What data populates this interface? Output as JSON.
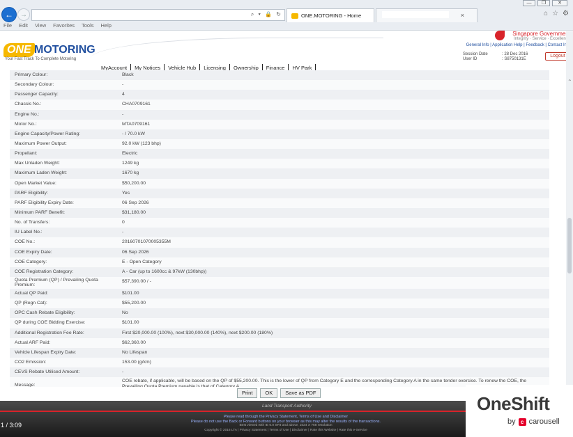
{
  "browser": {
    "tab_title": "ONE.MOTORING - Home",
    "menu": [
      "File",
      "Edit",
      "View",
      "Favorites",
      "Tools",
      "Help"
    ],
    "address_icons": "⌕ ▾ 🔒 ↻",
    "tab_close": "×",
    "window_controls": [
      "—",
      "❐",
      "✕"
    ],
    "toolbar_icons": [
      "⌂",
      "☆",
      "⚙"
    ]
  },
  "header": {
    "logo_one": "ONE",
    "logo_motoring": "MOTORING",
    "logo_tagline": "Your Fast Track To Complete Motoring",
    "gov_name": "Singapore Government",
    "gov_tagline": "Integrity · Service · Excellence",
    "util_links": "General Info | Application Help | Feedback | Contact Info",
    "session_label": "Session Date",
    "session_value": ": 28 Dec 2016",
    "user_label": "User ID",
    "user_value": ": S8750131E",
    "logout": "Logout",
    "nav": [
      "MyAccount",
      "My Notices",
      "Vehicle Hub",
      "Licensing",
      "Ownership",
      "Finance",
      "HV Park"
    ]
  },
  "details": [
    {
      "label": "Primary Colour:",
      "value": "Black"
    },
    {
      "label": "Secondary Colour:",
      "value": "-"
    },
    {
      "label": "Passenger Capacity:",
      "value": "4"
    },
    {
      "label": "Chassis No.:",
      "value": "CHA0709161"
    },
    {
      "label": "Engine No.:",
      "value": "-"
    },
    {
      "label": "Motor No.:",
      "value": "MTA0709161"
    },
    {
      "label": "Engine Capacity/Power Rating:",
      "value": "- / 70.0 kW"
    },
    {
      "label": "Maximum Power Output:",
      "value": "92.0 kW (123 bhp)"
    },
    {
      "label": "Propellant:",
      "value": "Electric"
    },
    {
      "label": "Max Unladen Weight:",
      "value": "1249 kg"
    },
    {
      "label": "Maximum Laden Weight:",
      "value": "1670 kg"
    },
    {
      "label": "Open Market Value:",
      "value": "$50,200.00"
    },
    {
      "label": "PARF Eligibility:",
      "value": "Yes"
    },
    {
      "label": "PARF Eligibility Expiry Date:",
      "value": "06 Sep 2026"
    },
    {
      "label": "Minimum PARF Benefit:",
      "value": "$31,180.00"
    },
    {
      "label": "No. of Transfers:",
      "value": "0"
    },
    {
      "label": "IU Label No.:",
      "value": "-"
    },
    {
      "label": "COE No.:",
      "value": "20160701070005355M"
    },
    {
      "label": "COE Expiry Date:",
      "value": "06 Sep 2026"
    },
    {
      "label": "COE Category:",
      "value": "E - Open Category"
    },
    {
      "label": "COE Registration Category:",
      "value": "A - Car (up to 1600cc & 97kW (130bhp))"
    },
    {
      "label": "Quota Premium (QP) / Prevailing Quota Premium:",
      "value": "$57,390.00 / -"
    },
    {
      "label": "Actual QP Paid:",
      "value": "$101.00"
    },
    {
      "label": "QP (Regn Cat):",
      "value": "$55,200.00"
    },
    {
      "label": "OPC Cash Rebate Eligibility:",
      "value": "No"
    },
    {
      "label": "QP during COE Bidding Exercise:",
      "value": "$101.00"
    },
    {
      "label": "Additional Registration Fee Rate:",
      "value": "First $20,000.00 (100%), next $30,000.00 (140%), next $200.00 (180%)"
    },
    {
      "label": "Actual ARF Paid:",
      "value": "$62,360.00"
    },
    {
      "label": "Vehicle Lifespan Expiry Date:",
      "value": "No Lifespan"
    },
    {
      "label": "CO2 Emission:",
      "value": "153.00 (g/km)"
    },
    {
      "label": "CEVS Rebate Utilised Amount:",
      "value": "-"
    },
    {
      "label": "Message:",
      "value": "COE rebate, if applicable, will be based on the QP of $55,200.00. This is the lower of QP from Category E and the corresponding Category A in the same tender exercise. To renew the COE, the Prevailing Quota Premium payable is that of Category A."
    }
  ],
  "buttons": {
    "print": "Print",
    "ok": "OK",
    "save_pdf": "Save as PDF"
  },
  "footer": {
    "lta": "Land Transport Authority",
    "line1": "Please read through the Privacy Statement, Terms of Use and Disclaimer",
    "line2": "Please do not use the Back or Forward buttons on your browser as this may alter the results of the transactions.",
    "line3": "Best viewed with IE 6.0 SP3 and above, 1024 X 768 resolution",
    "line4": "Copyright © 2016 LTA  |  Privacy Statement  |  Terms of Use  |  Disclaimer  |  Rate this Website  |  Rate this e-Service"
  },
  "video": {
    "time": "/ 3:09",
    "position": "1"
  },
  "badge": {
    "name": "OneShift",
    "by": "by",
    "carousell": "carousell",
    "carousell_icon": "c"
  }
}
